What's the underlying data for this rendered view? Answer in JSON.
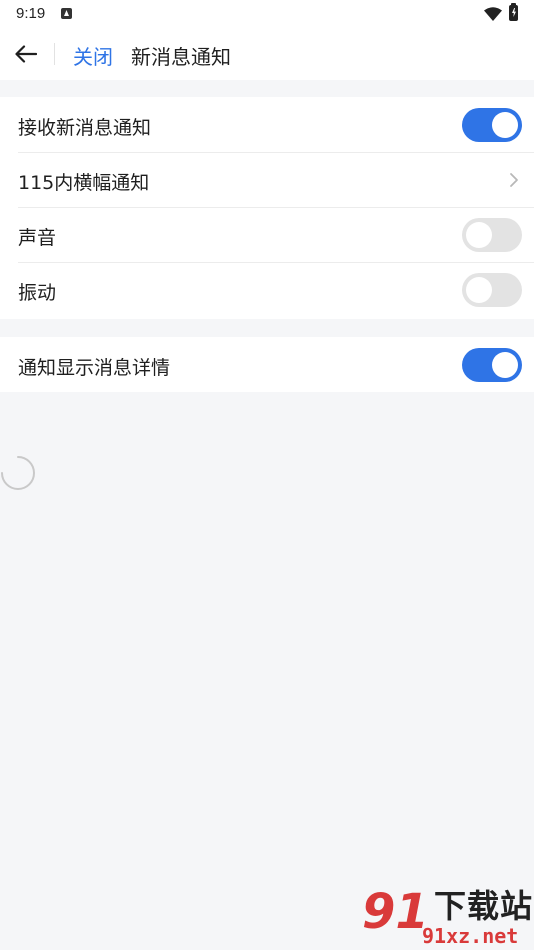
{
  "status_bar": {
    "time": "9:19",
    "notification_icon": "notification-a-icon",
    "wifi_icon": "wifi-icon",
    "battery_icon": "battery-charging-icon"
  },
  "header": {
    "back_icon": "arrow-left-icon",
    "close_label": "关闭",
    "title": "新消息通知"
  },
  "settings": {
    "group1": [
      {
        "label": "接收新消息通知",
        "control": "toggle",
        "on": true
      },
      {
        "label": "115内横幅通知",
        "control": "chevron"
      },
      {
        "label": "声音",
        "control": "toggle",
        "on": false
      },
      {
        "label": "振动",
        "control": "toggle",
        "on": false
      }
    ],
    "group2": [
      {
        "label": "通知显示消息详情",
        "control": "toggle",
        "on": true
      }
    ]
  },
  "colors": {
    "accent": "#2f74e6",
    "toggle_off": "#e3e3e3",
    "background": "#f5f6f8",
    "watermark_red": "#d93a3a"
  },
  "watermark": {
    "logo_text": "91",
    "title": "下载站",
    "url": "91xz.net"
  }
}
